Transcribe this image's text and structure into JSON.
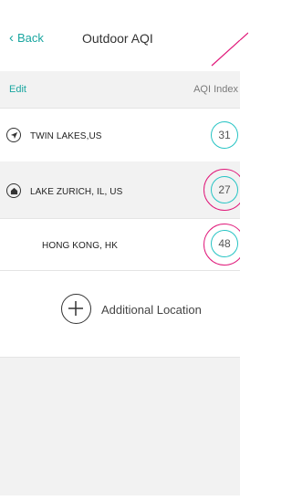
{
  "header": {
    "back_label": "Back",
    "title": "Outdoor AQI"
  },
  "subbar": {
    "edit_label": "Edit",
    "column_label": "AQI Index"
  },
  "locations": [
    {
      "name": "TWIN LAKES,US",
      "aqi": "31",
      "icon": "navigation-arrow-icon"
    },
    {
      "name": "LAKE ZURICH, IL, US",
      "aqi": "27",
      "icon": "home-icon"
    },
    {
      "name": "HONG KONG, HK",
      "aqi": "48",
      "icon": ""
    }
  ],
  "add_location": {
    "label": "Additional Location",
    "icon": "plus-circle-icon"
  },
  "colors": {
    "accent": "#1aa6a0",
    "badge_border": "#27c4c4",
    "annotation": "#e0197a"
  }
}
